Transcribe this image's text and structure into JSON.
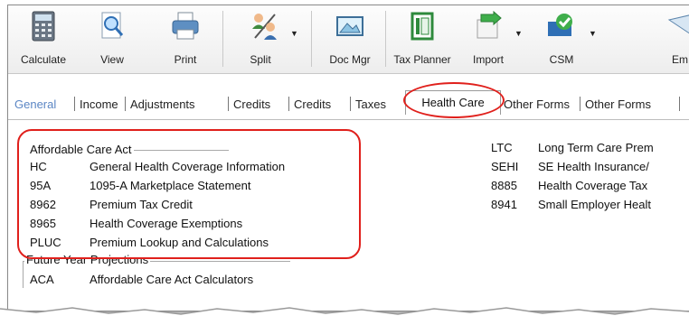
{
  "toolbar": {
    "buttons": [
      {
        "label": "Calculate",
        "icon": "calculator-icon"
      },
      {
        "label": "View",
        "icon": "magnifier-document-icon"
      },
      {
        "label": "Print",
        "icon": "printer-icon"
      },
      {
        "label": "Split",
        "icon": "split-people-icon"
      },
      {
        "label": "Doc Mgr",
        "icon": "document-manager-icon"
      },
      {
        "label": "Tax Planner",
        "icon": "tax-planner-icon"
      },
      {
        "label": "Import",
        "icon": "import-icon"
      },
      {
        "label": "CSM",
        "icon": "csm-icon"
      },
      {
        "label": "Em",
        "icon": "email-icon"
      }
    ]
  },
  "tabs": {
    "items": [
      "General",
      "Income",
      "Adjustments",
      "Credits",
      "Credits",
      "Taxes",
      "Health Care",
      "Other Forms",
      "Other Forms"
    ],
    "active": "Health Care"
  },
  "groups": {
    "aca": {
      "title": "Affordable Care Act",
      "rows": [
        {
          "code": "HC",
          "desc": "General Health Coverage Information"
        },
        {
          "code": "95A",
          "desc": "1095-A Marketplace Statement"
        },
        {
          "code": "8962",
          "desc": "Premium Tax Credit"
        },
        {
          "code": "8965",
          "desc": "Health Coverage Exemptions"
        },
        {
          "code": "PLUC",
          "desc": "Premium Lookup and Calculations"
        }
      ]
    },
    "future": {
      "title": "Future Year Projections",
      "rows": [
        {
          "code": "ACA",
          "desc": "Affordable Care Act Calculators"
        }
      ]
    },
    "right": {
      "rows": [
        {
          "code": "LTC",
          "desc": "Long Term Care Prem"
        },
        {
          "code": "SEHI",
          "desc": "SE Health Insurance/"
        },
        {
          "code": "8885",
          "desc": "Health Coverage Tax"
        },
        {
          "code": "8941",
          "desc": "Small Employer Healt"
        }
      ]
    }
  },
  "colors": {
    "highlight": "#e0201c",
    "inactive_tab": "#5b86c4"
  }
}
